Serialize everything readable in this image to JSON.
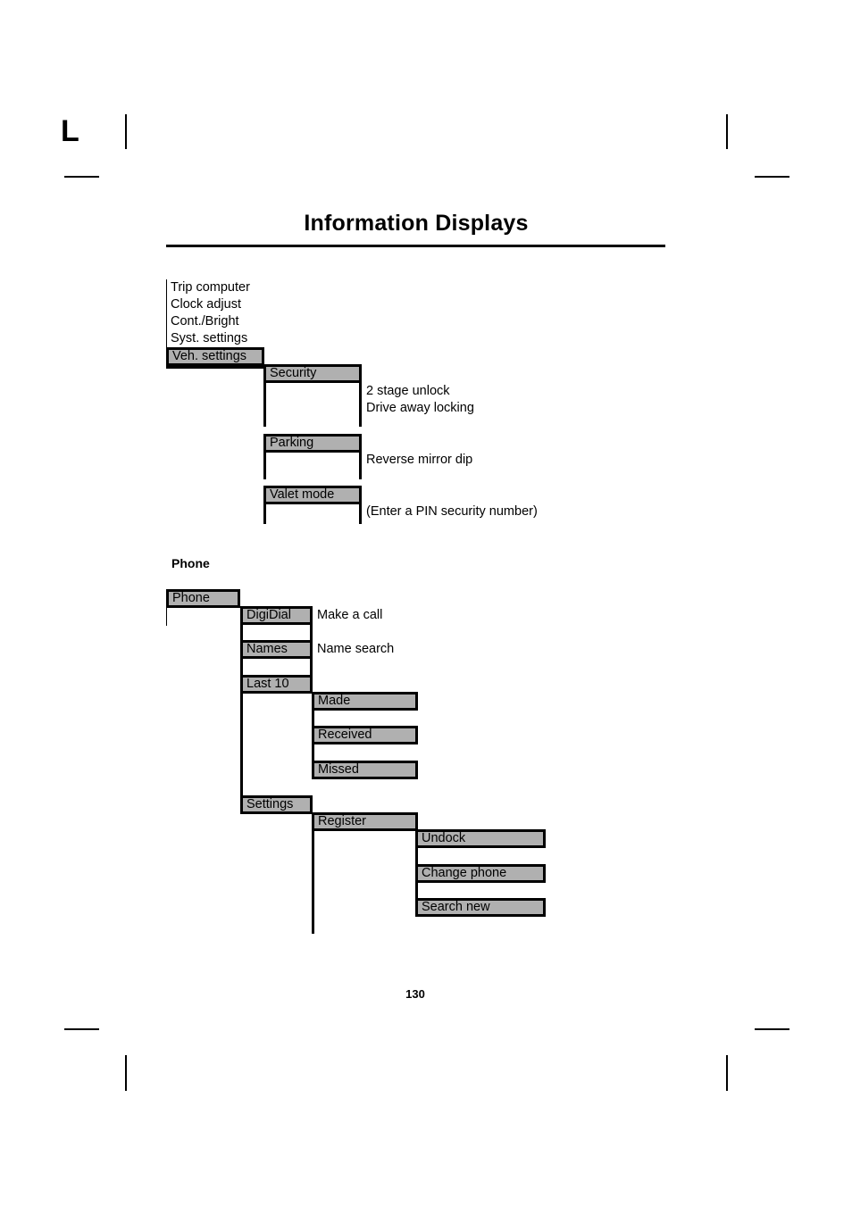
{
  "page": {
    "title": "Information Displays",
    "folio": "130",
    "fold_mark_letter": "L",
    "colors": {
      "box_fill": "#b0b0b0",
      "box_border": "#000000",
      "text": "#000000",
      "background": "#ffffff"
    }
  },
  "top_menu": {
    "items": [
      {
        "label": "Trip computer",
        "style": "plain"
      },
      {
        "label": "Clock adjust",
        "style": "plain"
      },
      {
        "label": "Cont./Bright",
        "style": "plain"
      },
      {
        "label": "Syst. settings",
        "style": "plain"
      },
      {
        "label": "Veh. settings",
        "style": "box"
      }
    ]
  },
  "veh_settings": {
    "children": [
      {
        "label": "Security",
        "notes": [
          "2 stage unlock",
          "Drive away locking"
        ]
      },
      {
        "label": "Parking",
        "notes": [
          "Reverse mirror dip"
        ]
      },
      {
        "label": "Valet mode",
        "notes": [
          "(Enter a PIN security number)"
        ]
      }
    ]
  },
  "phone_section": {
    "heading": "Phone",
    "root": {
      "label": "Phone"
    },
    "children": [
      {
        "label": "DigiDial",
        "note": "Make a call"
      },
      {
        "label": "Names",
        "note": "Name search"
      },
      {
        "label": "Last 10",
        "note": ""
      },
      {
        "label": "Settings",
        "note": ""
      }
    ],
    "last_10_children": [
      {
        "label": "Made"
      },
      {
        "label": "Received"
      },
      {
        "label": "Missed"
      }
    ],
    "settings_children": [
      {
        "label": "Register"
      }
    ],
    "register_children": [
      {
        "label": "Undock"
      },
      {
        "label": "Change phone"
      },
      {
        "label": "Search new"
      }
    ]
  }
}
